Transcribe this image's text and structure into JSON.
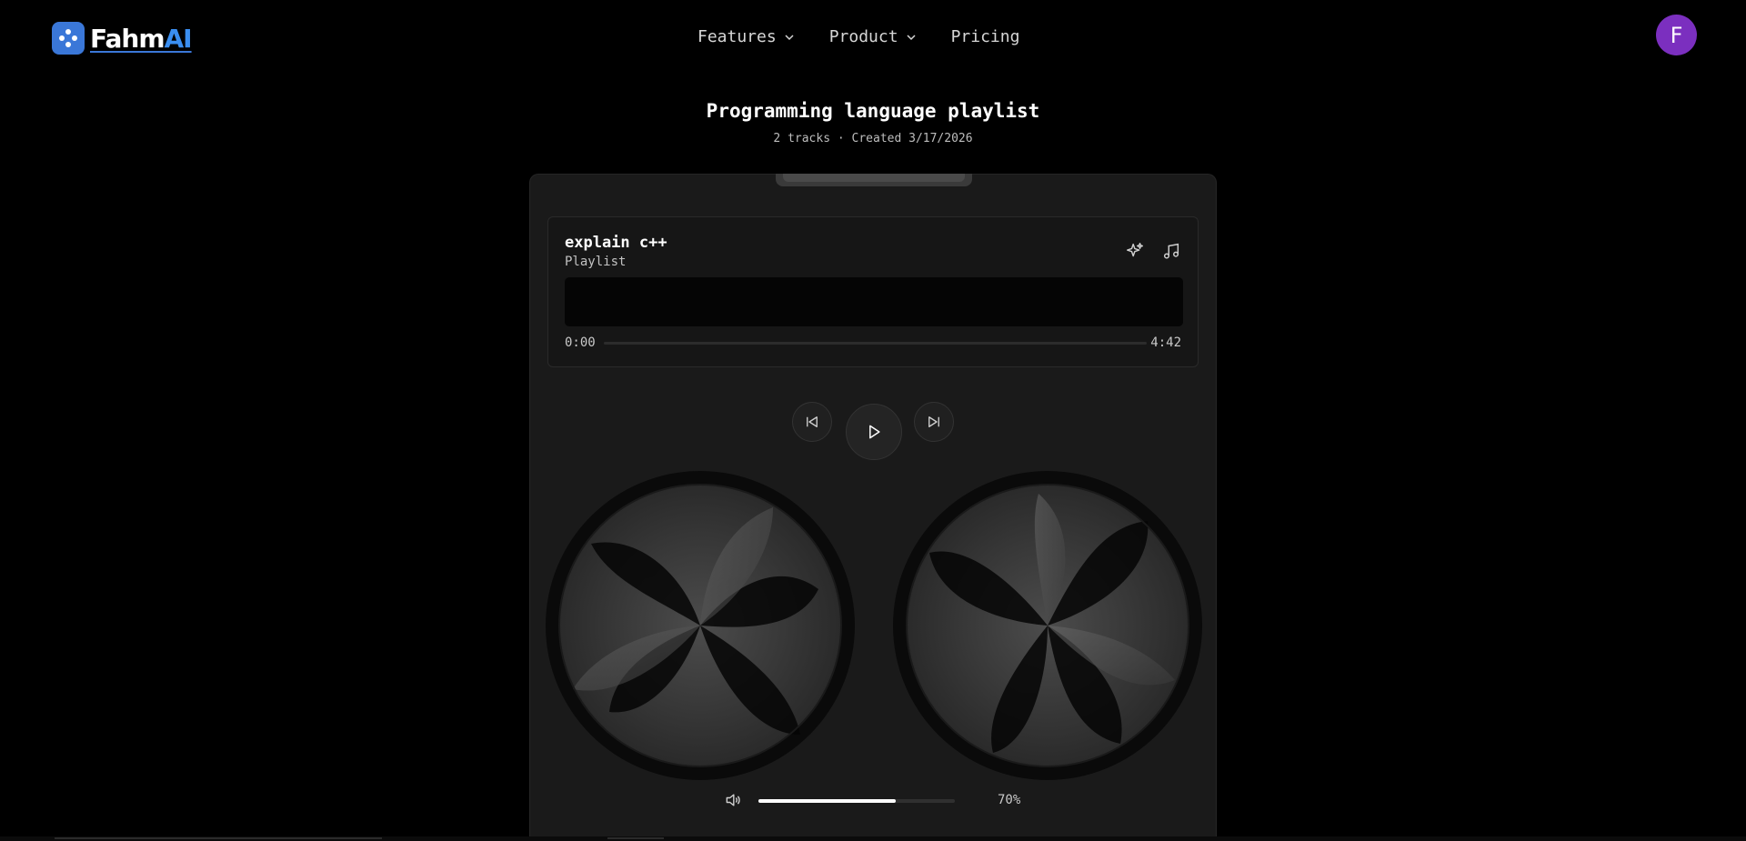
{
  "header": {
    "logo_text_main": "Fahm",
    "logo_text_accent": "AI",
    "nav": [
      {
        "label": "Features",
        "has_dropdown": true
      },
      {
        "label": "Product",
        "has_dropdown": true
      },
      {
        "label": "Pricing",
        "has_dropdown": false
      }
    ],
    "avatar_initial": "F",
    "avatar_color": "#7b2fbf"
  },
  "page": {
    "title": "Programming language playlist",
    "meta": "2 tracks · Created 3/17/2026"
  },
  "player": {
    "track_title": "explain c++",
    "track_subtitle": "Playlist",
    "icons": [
      "sparkles-icon",
      "music-note-icon"
    ],
    "time_current": "0:00",
    "time_total": "4:42",
    "progress_fraction": 0,
    "controls": [
      "previous-icon",
      "play-icon",
      "next-icon"
    ],
    "volume_label": "70%",
    "volume_fraction": 0.7,
    "volume_icon": "speaker-icon"
  },
  "colors": {
    "background": "#000000",
    "device": "#1a1a1a",
    "brand": "#3a77d8"
  }
}
